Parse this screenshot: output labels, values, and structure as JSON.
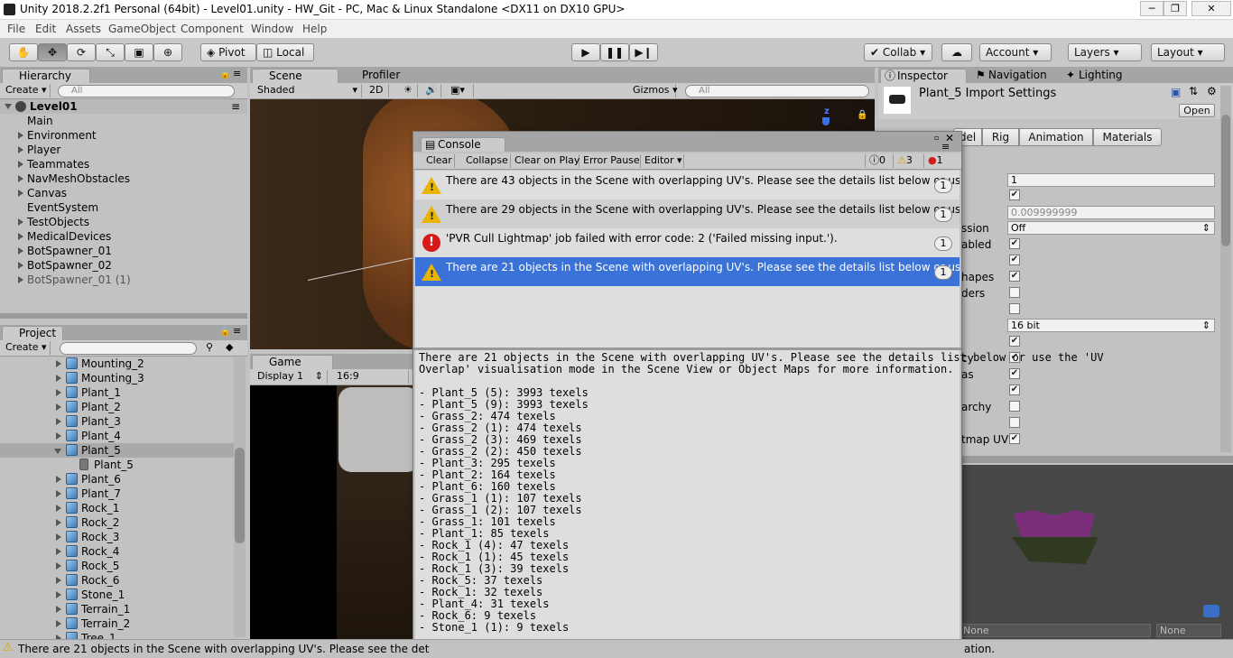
{
  "window": {
    "title": "Unity 2018.2.2f1 Personal (64bit) - Level01.unity - HW_Git - PC, Mac & Linux Standalone <DX11 on DX10 GPU>",
    "controls": [
      "─",
      "❐",
      "✕"
    ]
  },
  "menu": [
    "File",
    "Edit",
    "Assets",
    "GameObject",
    "Component",
    "Window",
    "Help"
  ],
  "toolbar": {
    "pivot": "Pivot",
    "local": "Local",
    "collab": "Collab",
    "account": "Account",
    "layers": "Layers",
    "layout": "Layout"
  },
  "hierarchy": {
    "tab": "Hierarchy",
    "create": "Create",
    "search_placeholder": "All",
    "scene": "Level01",
    "items": [
      {
        "label": "Main",
        "expandable": false
      },
      {
        "label": "Environment",
        "expandable": true
      },
      {
        "label": "Player",
        "expandable": true
      },
      {
        "label": "Teammates",
        "expandable": true
      },
      {
        "label": "NavMeshObstacles",
        "expandable": true
      },
      {
        "label": "Canvas",
        "expandable": true
      },
      {
        "label": "EventSystem",
        "expandable": false
      },
      {
        "label": "TestObjects",
        "expandable": true
      },
      {
        "label": "MedicalDevices",
        "expandable": true
      },
      {
        "label": "BotSpawner_01",
        "expandable": true
      },
      {
        "label": "BotSpawner_02",
        "expandable": true
      },
      {
        "label": "BotSpawner_01 (1)",
        "expandable": true
      }
    ]
  },
  "project": {
    "tab": "Project",
    "create": "Create",
    "items": [
      {
        "label": "Mounting_2",
        "child": false
      },
      {
        "label": "Mounting_3",
        "child": false
      },
      {
        "label": "Plant_1",
        "child": false
      },
      {
        "label": "Plant_2",
        "child": false
      },
      {
        "label": "Plant_3",
        "child": false
      },
      {
        "label": "Plant_4",
        "child": false
      },
      {
        "label": "Plant_5",
        "child": false,
        "expanded": true,
        "selected": true
      },
      {
        "label": "Plant_5",
        "child": true
      },
      {
        "label": "Plant_6",
        "child": false
      },
      {
        "label": "Plant_7",
        "child": false
      },
      {
        "label": "Rock_1",
        "child": false
      },
      {
        "label": "Rock_2",
        "child": false
      },
      {
        "label": "Rock_3",
        "child": false
      },
      {
        "label": "Rock_4",
        "child": false
      },
      {
        "label": "Rock_5",
        "child": false
      },
      {
        "label": "Rock_6",
        "child": false
      },
      {
        "label": "Stone_1",
        "child": false
      },
      {
        "label": "Terrain_1",
        "child": false
      },
      {
        "label": "Terrain_2",
        "child": false
      },
      {
        "label": "Tree_1",
        "child": false
      }
    ]
  },
  "scene": {
    "tab_scene": "Scene",
    "tab_profiler": "Profiler",
    "shading": "Shaded",
    "mode_2d": "2D",
    "gizmos": "Gizmos",
    "search_placeholder": "All",
    "axis": "z"
  },
  "game": {
    "tab": "Game",
    "display": "Display 1",
    "aspect": "16:9"
  },
  "console": {
    "title": "Console",
    "buttons": [
      "Clear",
      "Collapse",
      "Clear on Play",
      "Error Pause",
      "Editor"
    ],
    "counts": {
      "info": "0",
      "warnings": "3",
      "errors": "1"
    },
    "entries": [
      {
        "type": "warning",
        "text": "There are 43 objects in the Scene with overlapping UV's. Please see the details list below or use the",
        "count": "1",
        "selected": false
      },
      {
        "type": "warning",
        "text": "There are 29 objects in the Scene with overlapping UV's. Please see the details list below or use the",
        "count": "1",
        "selected": false
      },
      {
        "type": "error",
        "text": "'PVR Cull Lightmap' job failed with error code: 2 ('Failed missing input.').",
        "count": "1",
        "selected": false
      },
      {
        "type": "warning",
        "text": "There are 21 objects in the Scene with overlapping UV's. Please see the details list below or use the",
        "count": "1",
        "selected": true
      }
    ],
    "detail_header": [
      "There are 21 objects in the Scene with overlapping UV's. Please see the details list below or use the 'UV",
      "Overlap' visualisation mode in the Scene View or Object Maps for more information."
    ],
    "detail_items": [
      "- Plant_5 (5): 3993 texels",
      "- Plant_5 (9): 3993 texels",
      "- Grass_2: 474 texels",
      "- Grass_2 (1): 474 texels",
      "- Grass_2 (3): 469 texels",
      "- Grass_2 (2): 450 texels",
      "- Plant_3: 295 texels",
      "- Plant_2: 164 texels",
      "- Plant_6: 160 texels",
      "- Grass_1 (1): 107 texels",
      "- Grass_1 (2): 107 texels",
      "- Grass_1: 101 texels",
      "- Plant_1: 85 texels",
      "- Rock_1 (4): 47 texels",
      "- Rock_1 (1): 45 texels",
      "- Rock_1 (3): 39 texels",
      "- Rock_5: 37 texels",
      "- Rock_1: 32 texels",
      "- Plant_4: 31 texels",
      "- Rock_6: 9 texels",
      "- Stone_1 (1): 9 texels"
    ]
  },
  "inspector": {
    "tabs": [
      "Inspector",
      "Navigation",
      "Lighting"
    ],
    "title": "Plant_5 Import Settings",
    "open": "Open",
    "subtabs": [
      "del",
      "Rig",
      "Animation",
      "Materials"
    ],
    "fields": {
      "scale_factor": "1",
      "file_scale_value": "0.009999999",
      "compression": "Off",
      "index_format": "16 bit",
      "none1": "None",
      "none2": "None"
    },
    "partial_labels": [
      "ssion",
      "abled",
      "hapes",
      "ders",
      "cy",
      "as",
      "archy",
      "tmap UV"
    ]
  },
  "status": {
    "message": "There are 21 objects in the Scene with overlapping UV's. Please see the det",
    "tail": "ation."
  },
  "colors": {
    "selected_row": "#3a72d8",
    "panel_bg": "#c2c2c2",
    "warning": "#e9b400",
    "error": "#d61a1a",
    "mesh_preview": "#7a2f7a"
  }
}
